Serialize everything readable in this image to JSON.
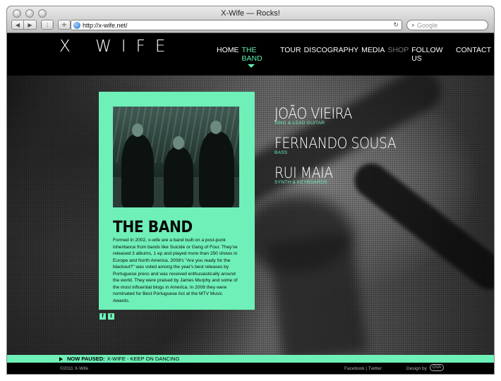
{
  "browser": {
    "window_title": "X-Wife — Rocks!",
    "url": "http://x-wife.net/",
    "search_placeholder": "Google",
    "back_glyph": "◀",
    "forward_glyph": "▶",
    "plus_glyph": "+",
    "grid_glyph": "⋮⋮⋮",
    "reload_glyph": "↻",
    "search_glyph": "⌕"
  },
  "site": {
    "logo": "X WIFE",
    "nav": {
      "home": "HOME",
      "the_band": "THE BAND",
      "tour": "TOUR",
      "discography": "DISCOGRAPHY",
      "media": "MEDIA",
      "shop": "SHOP",
      "follow_us": "FOLLOW US",
      "contact": "CONTACT"
    },
    "band": {
      "title": "THE BAND",
      "text": "Formed in 2002, x-wife are a band built on a post-punk inheritance from bands like Suicide or Gang of Four. They've released 3 albums, 1 ep and played more than 250 shows in Europe and North America. 2008's \"Are you ready for the blackout?\" was voted among the year's best releases by Portuguese press and was received enthusiastically around the world. They were praised by James Murphy and some of the most influential blogs in America. In 2009 they were nominated for Best Portuguese Act at the MTV Music Awards."
    },
    "social": {
      "facebook": "f",
      "twitter": "t"
    },
    "members": [
      {
        "name": "JOÃO VIEIRA",
        "role": "SING & LEAD GUITAR"
      },
      {
        "name": "FERNANDO SOUSA",
        "role": "BASS"
      },
      {
        "name": "RUI MAIA",
        "role": "SYNTH & KEYBOARDS"
      }
    ],
    "player": {
      "status": "NOW PAUSED:",
      "track": "X-WIFE - KEEP ON DANCING"
    },
    "footer": {
      "copyright": "©2011 X-Wife",
      "links": "Facebook | Twitter",
      "design_by": "Design by",
      "designer_logo": "OVA"
    }
  },
  "colors": {
    "accent": "#6ff0b8",
    "background": "#000000"
  }
}
